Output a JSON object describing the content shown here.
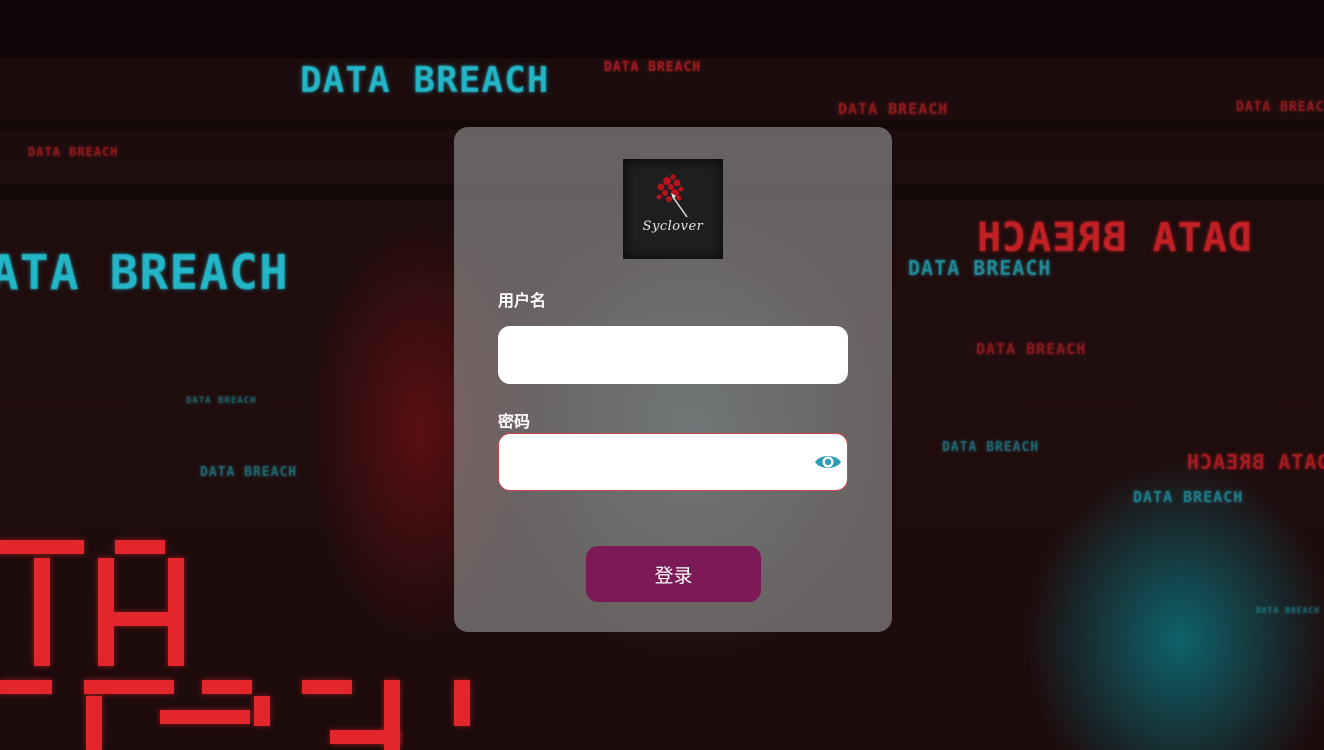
{
  "background": {
    "texts": [
      "DATA BREACH"
    ]
  },
  "login": {
    "logo_text": "Syclover",
    "username_label": "用户名",
    "username_value": "",
    "password_label": "密码",
    "password_value": "",
    "submit_label": "登录",
    "password_toggle_icon": "eye-icon"
  },
  "colors": {
    "button": "#7c1a58",
    "eye_icon": "#2b9fb4",
    "password_border": "#c9494f"
  }
}
